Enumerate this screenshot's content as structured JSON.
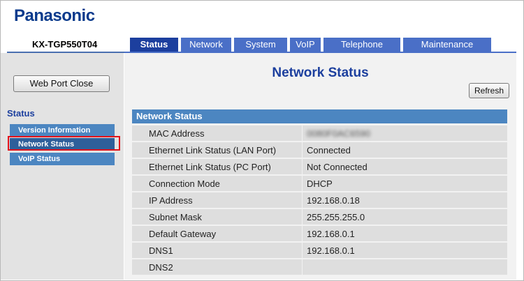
{
  "brand": "Panasonic",
  "model": "KX-TGP550T04",
  "tabs": [
    {
      "label": "Status",
      "active": true
    },
    {
      "label": "Network",
      "active": false
    },
    {
      "label": "System",
      "active": false
    },
    {
      "label": "VoIP",
      "active": false
    },
    {
      "label": "Telephone",
      "active": false
    },
    {
      "label": "Maintenance",
      "active": false
    }
  ],
  "sidebar": {
    "web_port_close": "Web Port Close",
    "section_title": "Status",
    "items": [
      {
        "label": "Version Information"
      },
      {
        "label": "Network Status",
        "selected": true
      },
      {
        "label": "VoIP Status"
      }
    ]
  },
  "main": {
    "title": "Network Status",
    "refresh": "Refresh",
    "section_header": "Network Status",
    "rows": [
      {
        "label": "MAC Address",
        "value": "0080F0AC6590"
      },
      {
        "label": "Ethernet Link Status (LAN Port)",
        "value": "Connected"
      },
      {
        "label": "Ethernet Link Status (PC Port)",
        "value": "Not Connected"
      },
      {
        "label": "Connection Mode",
        "value": "DHCP"
      },
      {
        "label": "IP Address",
        "value": "192.168.0.18"
      },
      {
        "label": "Subnet Mask",
        "value": "255.255.255.0"
      },
      {
        "label": "Default Gateway",
        "value": "192.168.0.1"
      },
      {
        "label": "DNS1",
        "value": "192.168.0.1"
      },
      {
        "label": "DNS2",
        "value": ""
      }
    ]
  },
  "colors": {
    "brand_blue": "#0a3a8c",
    "tab_blue": "#4a6fc7",
    "active_tab": "#1c3f9e",
    "section_blue": "#4c86c1",
    "highlight_red": "#e2121b"
  }
}
